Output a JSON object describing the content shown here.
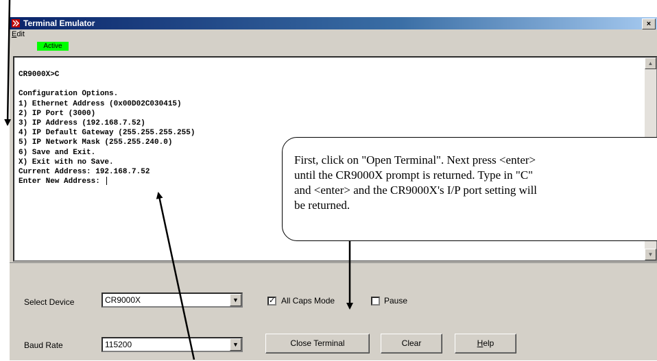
{
  "window": {
    "title": "Terminal Emulator",
    "close_label": "×",
    "menu": [
      "Edit"
    ],
    "status": "Active"
  },
  "terminal": {
    "lines": [
      "CR9000X>C",
      "",
      "Configuration Options.",
      "1) Ethernet Address (0x00D02C030415)",
      "2) IP Port (3000)",
      "3) IP Address (192.168.7.52)",
      "4) IP Default Gateway (255.255.255.255)",
      "5) IP Network Mask (255.255.240.0)",
      "6) Save and Exit.",
      "X) Exit with no Save.",
      "Current Address: 192.168.7.52",
      "Enter New Address: "
    ],
    "scroll_up_icon": "▲",
    "scroll_down_icon": "▼"
  },
  "controls": {
    "select_device_label": "Select Device",
    "select_device_value": "CR9000X",
    "baud_rate_label": "Baud Rate",
    "baud_rate_value": "115200",
    "all_caps_label": "All Caps Mode",
    "all_caps_checked": true,
    "pause_label": "Pause",
    "pause_checked": false,
    "close_terminal_label": "Close Terminal",
    "clear_label": "Clear",
    "help_label": "Help",
    "dropdown_icon": "▼",
    "check_mark": "✓"
  },
  "callout": {
    "lines": [
      "First, click on \"Open Terminal\".   Next press <enter>",
      "until the CR9000X prompt is returned.  Type in \"C\"",
      "and <enter> and the CR9000X's I/P port setting will",
      "be returned."
    ]
  },
  "colors": {
    "title_bar": "#0a246a",
    "status_active": "#00ff00",
    "window_face": "#d4d0c8"
  }
}
